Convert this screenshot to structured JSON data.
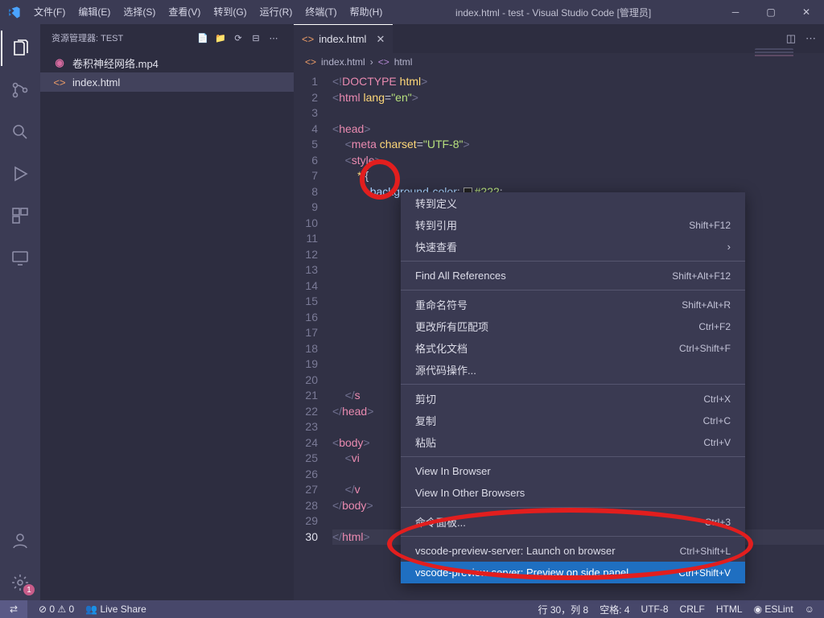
{
  "titlebar": {
    "menus": [
      "文件(F)",
      "编辑(E)",
      "选择(S)",
      "查看(V)",
      "转到(G)",
      "运行(R)",
      "终端(T)",
      "帮助(H)"
    ],
    "title": "index.html - test - Visual Studio Code [管理员]"
  },
  "activity": [
    {
      "name": "explorer",
      "active": true
    },
    {
      "name": "scm",
      "active": false
    },
    {
      "name": "search",
      "active": false
    },
    {
      "name": "run",
      "active": false
    },
    {
      "name": "extensions",
      "active": false
    },
    {
      "name": "remote",
      "active": false
    }
  ],
  "sidebar": {
    "title": "资源管理器: TEST",
    "files": [
      {
        "icon": "circle-pink",
        "label": "卷积神经网络.mp4",
        "selected": false
      },
      {
        "icon": "brackets-orange",
        "label": "index.html",
        "selected": true
      }
    ]
  },
  "tabs": [
    {
      "icon": "<>",
      "label": "index.html",
      "active": true
    }
  ],
  "breadcrumb": [
    {
      "icon": "<>",
      "text": "index.html"
    },
    {
      "icon": "<>",
      "text": "html"
    }
  ],
  "code": {
    "lines": [
      {
        "n": 1,
        "html": "<span class='t-gray'>&lt;!</span><span class='t-tag'>DOCTYPE</span> <span class='t-attr'>html</span><span class='t-gray'>&gt;</span>"
      },
      {
        "n": 2,
        "html": "<span class='t-gray'>&lt;</span><span class='t-tag'>html</span> <span class='t-attr'>lang</span><span class='t-pun'>=</span><span class='t-str'>\"en\"</span><span class='t-gray'>&gt;</span>"
      },
      {
        "n": 3,
        "html": ""
      },
      {
        "n": 4,
        "html": "<span class='t-gray'>&lt;</span><span class='t-tag'>head</span><span class='t-gray'>&gt;</span>"
      },
      {
        "n": 5,
        "html": "    <span class='t-gray'>&lt;</span><span class='t-tag'>meta</span> <span class='t-attr'>charset</span><span class='t-pun'>=</span><span class='t-str'>\"UTF-8\"</span><span class='t-gray'>&gt;</span>"
      },
      {
        "n": 6,
        "html": "    <span class='t-gray'>&lt;</span><span class='t-tag'>style</span><span class='t-gray'>&gt;</span>"
      },
      {
        "n": 7,
        "html": "        <span class='t-sel'>*</span> <span class='t-pun'>{</span>"
      },
      {
        "n": 8,
        "html": "            <span class='t-prop'>background-color</span><span class='t-pun'>:</span> <span class='swatch'></span><span class='t-str'>#222</span><span class='t-pun'>;</span>"
      },
      {
        "n": 9,
        "html": ""
      },
      {
        "n": 10,
        "html": ""
      },
      {
        "n": 11,
        "html": ""
      },
      {
        "n": 12,
        "html": ""
      },
      {
        "n": 13,
        "html": ""
      },
      {
        "n": 14,
        "html": ""
      },
      {
        "n": 15,
        "html": ""
      },
      {
        "n": 16,
        "html": ""
      },
      {
        "n": 17,
        "html": ""
      },
      {
        "n": 18,
        "html": ""
      },
      {
        "n": 19,
        "html": ""
      },
      {
        "n": 20,
        "html": ""
      },
      {
        "n": 21,
        "html": "    <span class='t-gray'>&lt;/</span><span class='t-tag'>s"
      },
      {
        "n": 22,
        "html": "<span class='t-gray'>&lt;/</span><span class='t-tag'>head</span><span class='t-gray'>&gt;"
      },
      {
        "n": 23,
        "html": ""
      },
      {
        "n": 24,
        "html": "<span class='t-gray'>&lt;</span><span class='t-tag'>body</span><span class='t-gray'>&gt;"
      },
      {
        "n": 25,
        "html": "    <span class='t-gray'>&lt;</span><span class='t-tag'>vi"
      },
      {
        "n": 26,
        "html": ""
      },
      {
        "n": 27,
        "html": "    <span class='t-gray'>&lt;/</span><span class='t-tag'>v"
      },
      {
        "n": 28,
        "html": "<span class='t-gray'>&lt;/</span><span class='t-tag'>body</span><span class='t-gray'>&gt;"
      },
      {
        "n": 29,
        "html": ""
      },
      {
        "n": 30,
        "html": "<span class='t-gray'>&lt;/</span><span class='t-tag'>html</span><span class='t-gray'>&gt;</span>",
        "current": true
      }
    ]
  },
  "context_menu": [
    {
      "label": "转到定义",
      "sc": ""
    },
    {
      "label": "转到引用",
      "sc": "Shift+F12"
    },
    {
      "label": "快速查看",
      "sc": "",
      "arrow": true
    },
    {
      "sep": true
    },
    {
      "label": "Find All References",
      "sc": "Shift+Alt+F12"
    },
    {
      "sep": true
    },
    {
      "label": "重命名符号",
      "sc": "Shift+Alt+R"
    },
    {
      "label": "更改所有匹配项",
      "sc": "Ctrl+F2"
    },
    {
      "label": "格式化文档",
      "sc": "Ctrl+Shift+F"
    },
    {
      "label": "源代码操作...",
      "sc": ""
    },
    {
      "sep": true
    },
    {
      "label": "剪切",
      "sc": "Ctrl+X"
    },
    {
      "label": "复制",
      "sc": "Ctrl+C"
    },
    {
      "label": "粘贴",
      "sc": "Ctrl+V"
    },
    {
      "sep": true
    },
    {
      "label": "View In Browser",
      "sc": ""
    },
    {
      "label": "View In Other Browsers",
      "sc": ""
    },
    {
      "sep": true
    },
    {
      "label": "命令面板...",
      "sc": "Ctrl+3"
    },
    {
      "sep": true
    },
    {
      "label": "vscode-preview-server: Launch on browser",
      "sc": "Ctrl+Shift+L"
    },
    {
      "label": "vscode-preview-server: Preview on side panel",
      "sc": "Ctrl+Shift+V",
      "hover": true
    }
  ],
  "statusbar": {
    "left": [
      "⊘ 0  ⚠ 0",
      "Live Share"
    ],
    "right": [
      "行 30，列 8",
      "空格: 4",
      "UTF-8",
      "CRLF",
      "HTML",
      "◉ ESLint",
      "☺"
    ]
  }
}
